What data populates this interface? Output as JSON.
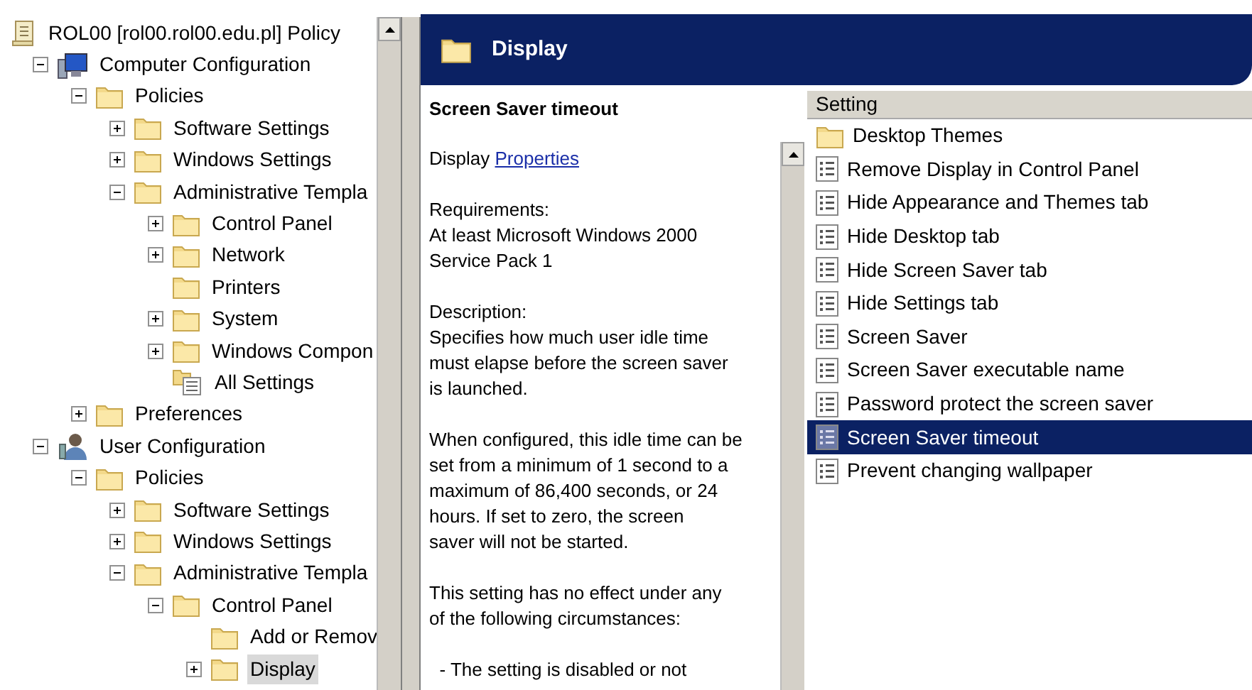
{
  "tree": {
    "items": [
      {
        "label": "ROL00 [rol00.rol00.edu.pl] Policy",
        "kind": "policy",
        "selected": false,
        "children": [
          {
            "label": "Computer Configuration",
            "kind": "computer",
            "expanded": true,
            "selected": false,
            "children": [
              {
                "label": "Policies",
                "kind": "folder",
                "expanded": true,
                "selected": false,
                "children": [
                  {
                    "label": "Software Settings",
                    "kind": "folder",
                    "expanded": false,
                    "selected": false
                  },
                  {
                    "label": "Windows Settings",
                    "kind": "folder",
                    "expanded": false,
                    "selected": false
                  },
                  {
                    "label": "Administrative Templa",
                    "kind": "folder",
                    "expanded": true,
                    "selected": false,
                    "children": [
                      {
                        "label": "Control Panel",
                        "kind": "folder",
                        "expanded": false,
                        "selected": false
                      },
                      {
                        "label": "Network",
                        "kind": "folder",
                        "expanded": false,
                        "selected": false
                      },
                      {
                        "label": "Printers",
                        "kind": "folder",
                        "selected": false
                      },
                      {
                        "label": "System",
                        "kind": "folder",
                        "expanded": false,
                        "selected": false
                      },
                      {
                        "label": "Windows Compon",
                        "kind": "folder",
                        "expanded": false,
                        "selected": false
                      },
                      {
                        "label": "All Settings",
                        "kind": "settings",
                        "selected": false
                      }
                    ]
                  }
                ]
              },
              {
                "label": "Preferences",
                "kind": "folder",
                "expanded": false,
                "selected": false
              }
            ]
          },
          {
            "label": "User Configuration",
            "kind": "user",
            "expanded": true,
            "selected": false,
            "children": [
              {
                "label": "Policies",
                "kind": "folder",
                "expanded": true,
                "selected": false,
                "children": [
                  {
                    "label": "Software Settings",
                    "kind": "folder",
                    "expanded": false,
                    "selected": false
                  },
                  {
                    "label": "Windows Settings",
                    "kind": "folder",
                    "expanded": false,
                    "selected": false
                  },
                  {
                    "label": "Administrative Templa",
                    "kind": "folder",
                    "expanded": true,
                    "selected": false,
                    "children": [
                      {
                        "label": "Control Panel",
                        "kind": "folder",
                        "expanded": true,
                        "selected": false,
                        "children": [
                          {
                            "label": "Add or Remov",
                            "kind": "folder",
                            "selected": false
                          },
                          {
                            "label": "Display",
                            "kind": "folder",
                            "expanded": false,
                            "selected": true
                          }
                        ]
                      }
                    ]
                  }
                ]
              }
            ]
          }
        ]
      }
    ]
  },
  "header": {
    "title": "Display"
  },
  "description": {
    "title": "Screen Saver timeout",
    "category": "Display",
    "link": "Properties",
    "paragraphs": [
      "Requirements:\nAt least Microsoft Windows 2000\nService Pack 1",
      "Description:\nSpecifies how much user idle time\nmust elapse before the screen saver\nis launched.",
      "When configured, this idle time can be\nset from a minimum of 1 second to a\nmaximum of 86,400 seconds, or 24\nhours. If set to zero, the screen\nsaver will not be started.",
      "This setting has no effect under any\nof the following circumstances:",
      "  - The setting is disabled or not"
    ]
  },
  "list": {
    "column": "Setting",
    "rows": [
      {
        "label": "Desktop Themes",
        "kind": "folder",
        "selected": false
      },
      {
        "label": "Remove Display in Control Panel",
        "kind": "setting",
        "selected": false
      },
      {
        "label": "Hide Appearance and Themes tab",
        "kind": "setting",
        "selected": false
      },
      {
        "label": "Hide Desktop tab",
        "kind": "setting",
        "selected": false
      },
      {
        "label": "Hide Screen Saver tab",
        "kind": "setting",
        "selected": false
      },
      {
        "label": "Hide Settings tab",
        "kind": "setting",
        "selected": false
      },
      {
        "label": "Screen Saver",
        "kind": "setting",
        "selected": false
      },
      {
        "label": "Screen Saver executable name",
        "kind": "setting",
        "selected": false
      },
      {
        "label": "Password protect the screen saver",
        "kind": "setting",
        "selected": false
      },
      {
        "label": "Screen Saver timeout",
        "kind": "setting",
        "selected": true
      },
      {
        "label": "Prevent changing wallpaper",
        "kind": "setting",
        "selected": false
      }
    ]
  }
}
